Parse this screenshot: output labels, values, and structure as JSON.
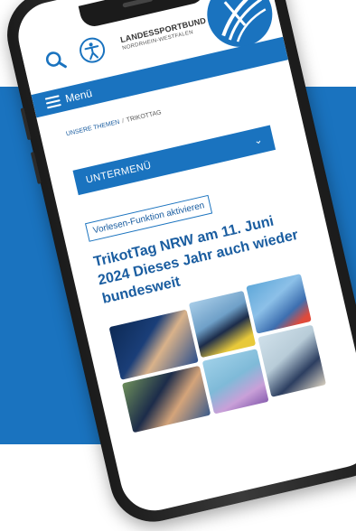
{
  "header": {
    "brand_line1": "LANDESSPORTBUND",
    "brand_line2": "NORDRHEIN-WESTFALEN"
  },
  "menu": {
    "label": "Menü"
  },
  "breadcrumb": {
    "parent": "UNSERE THEMEN",
    "separator": "/",
    "current": "TRIKOTTAG"
  },
  "submenu": {
    "label": "UNTERMENÜ"
  },
  "read_aloud": {
    "label": "Vorlesen-Funktion aktivieren"
  },
  "article": {
    "title": "TrikotTag NRW am 11. Juni 2024 Dieses Jahr auch wieder bundesweit"
  },
  "colors": {
    "brand_blue": "#1a73bf",
    "background": "#ffffff"
  },
  "icons": [
    "search-icon",
    "accessibility-icon",
    "menu-icon",
    "chevron-down-icon"
  ]
}
